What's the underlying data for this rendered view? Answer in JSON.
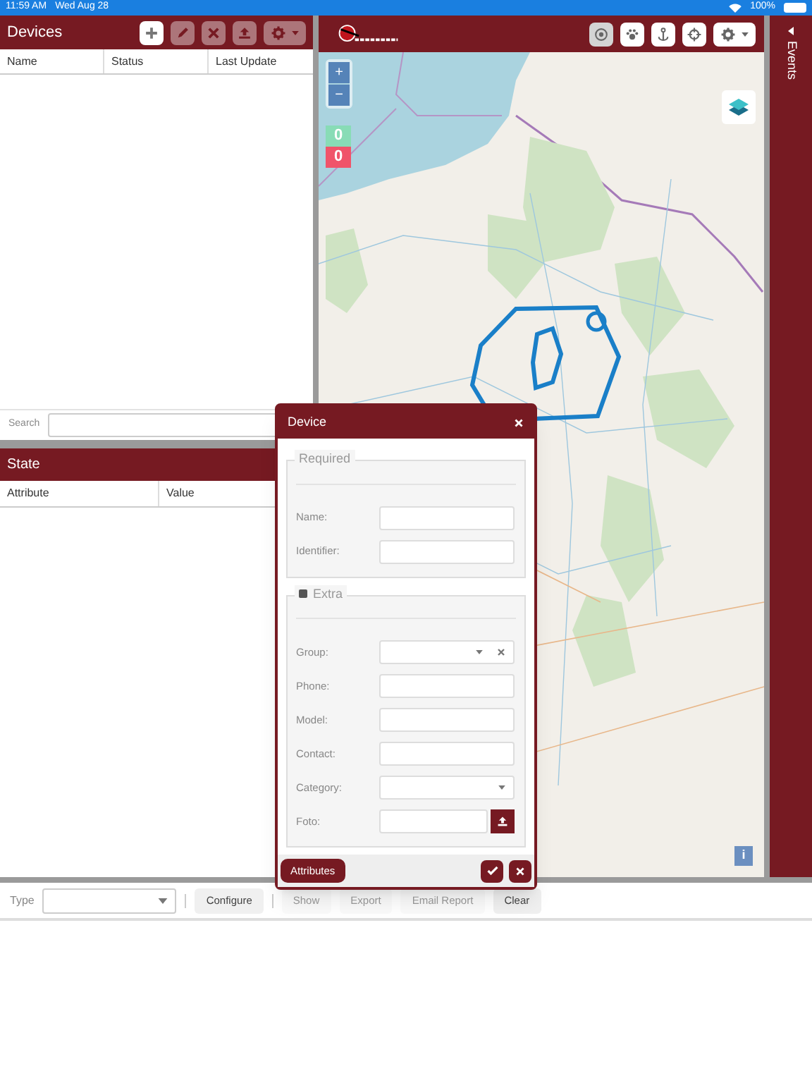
{
  "status_bar": {
    "time": "11:59 AM",
    "date": "Wed Aug 28",
    "battery": "100%"
  },
  "devices_panel": {
    "title": "Devices",
    "toolbar": [
      {
        "kind": "add",
        "disabled": false
      },
      {
        "kind": "edit",
        "disabled": true
      },
      {
        "kind": "remove",
        "disabled": true
      },
      {
        "kind": "upload",
        "disabled": true
      },
      {
        "kind": "settings",
        "disabled": true
      }
    ],
    "columns": [
      "Name",
      "Status",
      "Last Update"
    ],
    "search": {
      "label": "Search"
    }
  },
  "state_panel": {
    "title": "State",
    "columns": [
      "Attribute",
      "Value"
    ]
  },
  "map": {
    "toolbar": [
      {
        "kind": "target",
        "selected": true
      },
      {
        "kind": "paw",
        "selected": false
      },
      {
        "kind": "anchor",
        "selected": false
      },
      {
        "kind": "crosshair",
        "selected": false
      },
      {
        "kind": "settings",
        "selected": false
      }
    ],
    "zoom_in": "+",
    "zoom_out": "−",
    "counters": [
      {
        "kind": "online",
        "value": "0"
      },
      {
        "kind": "offline",
        "value": "0"
      }
    ],
    "info": "i"
  },
  "events_panel": {
    "title": "Events"
  },
  "bottom_toolbar": {
    "type_label": "Type",
    "buttons": [
      {
        "label": "Configure",
        "disabled": false
      },
      {
        "label": "Show",
        "disabled": true
      },
      {
        "label": "Export",
        "disabled": true
      },
      {
        "label": "Email Report",
        "disabled": true
      },
      {
        "label": "Clear",
        "disabled": false
      }
    ]
  },
  "dialog": {
    "title": "Device",
    "sections": [
      {
        "title": "Required",
        "collapsible": false,
        "fields": [
          {
            "label": "Name:",
            "kind": "text"
          },
          {
            "label": "Identifier:",
            "kind": "text"
          }
        ]
      },
      {
        "title": "Extra",
        "collapsible": true,
        "fields": [
          {
            "label": "Group:",
            "kind": "combo_clear"
          },
          {
            "label": "Phone:",
            "kind": "text"
          },
          {
            "label": "Model:",
            "kind": "text"
          },
          {
            "label": "Contact:",
            "kind": "text"
          },
          {
            "label": "Category:",
            "kind": "combo"
          },
          {
            "label": "Foto:",
            "kind": "upload"
          }
        ]
      }
    ],
    "attributes_button": "Attributes"
  }
}
